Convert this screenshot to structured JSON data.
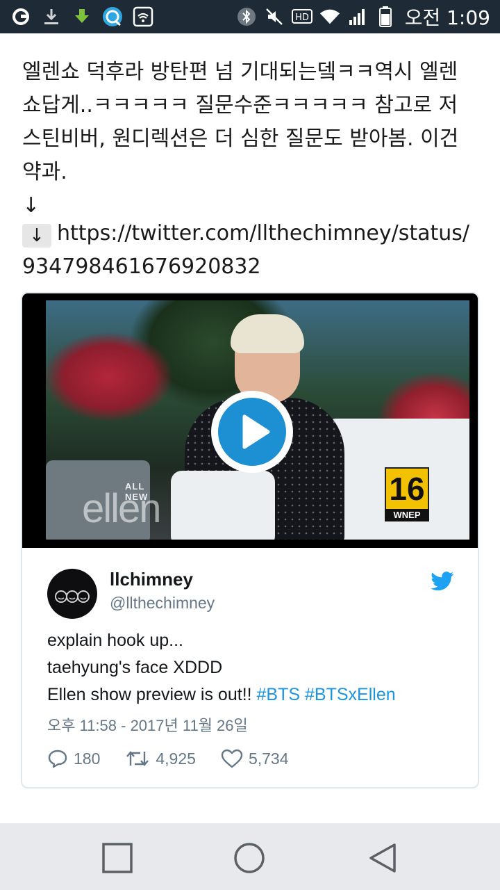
{
  "status_bar": {
    "left_icons": [
      "app-g-icon",
      "download-icon",
      "download-green-icon",
      "browser-icon",
      "wifi-box-icon"
    ],
    "right_icons": [
      "bluetooth-icon",
      "mute-icon",
      "hd-icon",
      "wifi-icon",
      "signal-icon",
      "battery-icon"
    ],
    "hd_label": "HD",
    "time": "오전 1:09"
  },
  "post": {
    "text_lines": [
      "엘렌쇼 덕후라 방탄편 넘 기대되는뎈ㅋㅋ역시 엘렌",
      "쇼답게..ㅋㅋㅋㅋㅋ 질문수준ㅋㅋㅋㅋㅋ 참고로 저",
      "스틴비버, 원디렉션은 더 심한 질문도 받아봄. 이건",
      "약과."
    ],
    "arrow": "↓",
    "link_arrow": "↓",
    "link": "https://twitter.com/llthechimney/status/934798461676920832"
  },
  "video": {
    "logo_small": "ALL NEW",
    "logo_word": "ellen",
    "station_number": "16",
    "station_call": "WNEP"
  },
  "tweet": {
    "display_name": "llchimney",
    "handle": "@llthechimney",
    "lines": [
      "explain hook up...",
      "taehyung's face XDDD",
      "Ellen show preview is out!! "
    ],
    "hashtags": [
      "#BTS",
      "#BTSxEllen"
    ],
    "date": "오후 11:58 - 2017년 11월 26일",
    "replies": "180",
    "retweets": "4,925",
    "likes": "5,734"
  },
  "colors": {
    "status_bar_bg": "#1e2b36",
    "hashtag": "#1b95e0",
    "play_button": "#1d8fd3",
    "nav_bar_bg": "#e8e9ec"
  }
}
